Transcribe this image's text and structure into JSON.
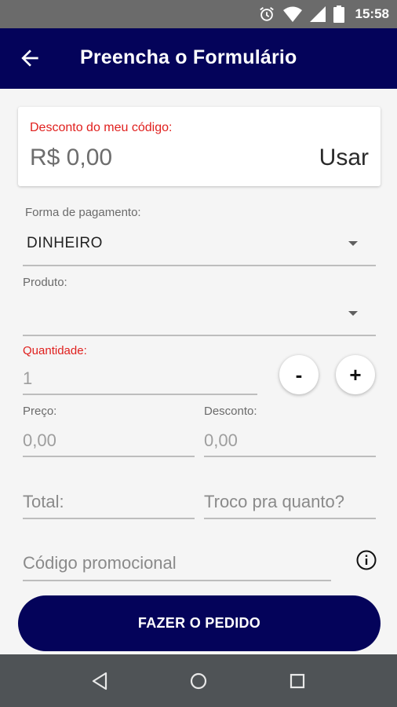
{
  "status_bar": {
    "time": "15:58",
    "icons": [
      "alarm-icon",
      "wifi-icon",
      "signal-icon",
      "battery-icon"
    ]
  },
  "app_bar": {
    "title": "Preencha o Formulário",
    "back_icon": "arrow-back-icon"
  },
  "discount_card": {
    "label": "Desconto do meu código:",
    "amount": "R$ 0,00",
    "use_label": "Usar"
  },
  "payment": {
    "label": "Forma de pagamento:",
    "value": "DINHEIRO"
  },
  "product": {
    "label": "Produto:",
    "value": ""
  },
  "quantity": {
    "label": "Quantidade:",
    "value": "1",
    "minus_label": "-",
    "plus_label": "+"
  },
  "price": {
    "label": "Preço:",
    "value": "0,00"
  },
  "discount": {
    "label": "Desconto:",
    "value": "0,00"
  },
  "total": {
    "placeholder": "Total:"
  },
  "change": {
    "placeholder": "Troco pra quanto?"
  },
  "promo": {
    "placeholder": "Código promocional",
    "info_icon": "info-icon"
  },
  "submit": {
    "label": "FAZER O PEDIDO"
  },
  "nav_bar": {
    "icons": [
      "back-triangle-icon",
      "home-circle-icon",
      "recents-square-icon"
    ]
  },
  "colors": {
    "primary": "#04035a",
    "error": "#e0201e",
    "status_bar": "#6b6b6b",
    "nav_bar": "#4f5356"
  }
}
